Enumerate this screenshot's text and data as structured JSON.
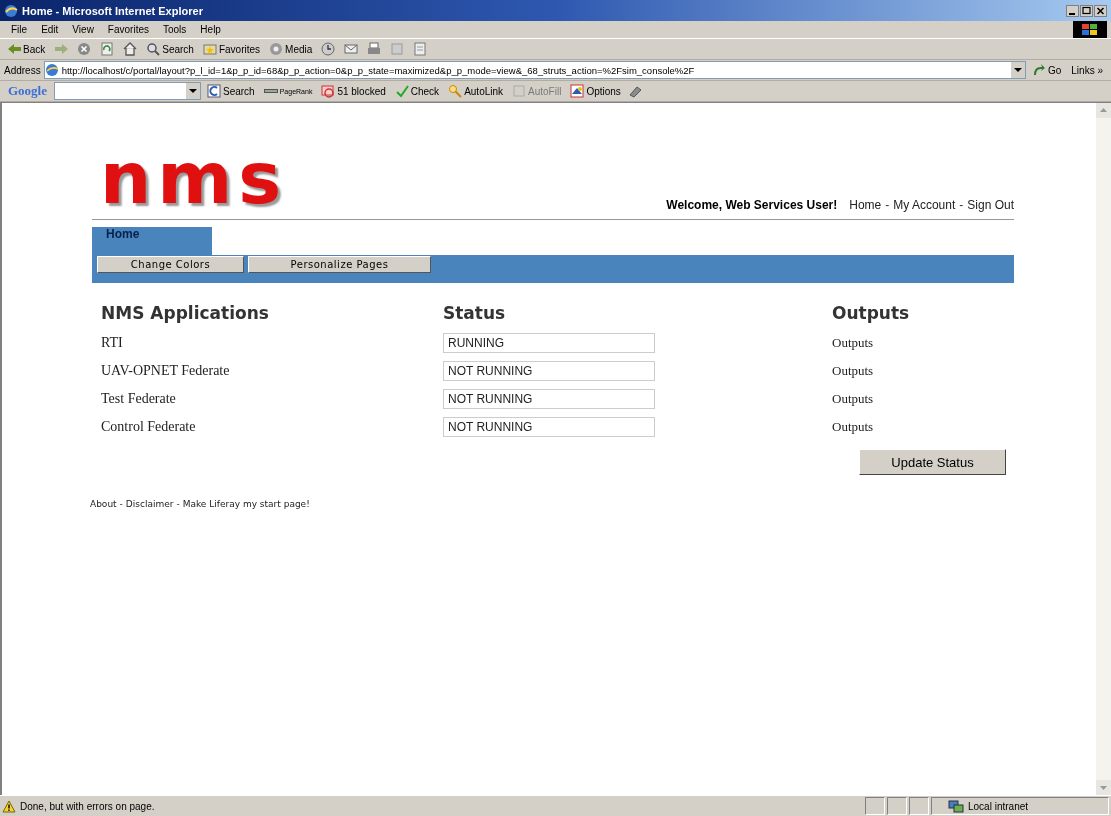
{
  "window": {
    "title": "Home - Microsoft Internet Explorer"
  },
  "menu": [
    "File",
    "Edit",
    "View",
    "Favorites",
    "Tools",
    "Help"
  ],
  "toolbar": [
    {
      "kind": "back",
      "label": "Back"
    },
    {
      "kind": "forward"
    },
    {
      "kind": "stop"
    },
    {
      "kind": "refresh"
    },
    {
      "kind": "home"
    },
    {
      "kind": "search",
      "label": "Search"
    },
    {
      "kind": "favorites",
      "label": "Favorites"
    },
    {
      "kind": "media",
      "label": "Media"
    },
    {
      "kind": "history"
    },
    {
      "kind": "mail"
    },
    {
      "kind": "print"
    },
    {
      "kind": "edit"
    },
    {
      "kind": "discuss"
    }
  ],
  "address": {
    "label": "Address",
    "url": "http://localhost/c/portal/layout?p_l_id=1&p_p_id=68&p_p_action=0&p_p_state=maximized&p_p_mode=view&_68_struts_action=%2Fsim_console%2F",
    "go": "Go",
    "links": "Links »"
  },
  "google_toolbar": {
    "logo": "Google",
    "items": [
      {
        "kind": "search",
        "label": "Search",
        "disabled": false
      },
      {
        "kind": "pagerank",
        "label": "PageRank",
        "disabled": false
      },
      {
        "kind": "blocked",
        "label": "51 blocked",
        "disabled": false
      },
      {
        "kind": "check",
        "label": "Check",
        "disabled": false
      },
      {
        "kind": "autolink",
        "label": "AutoLink",
        "disabled": false
      },
      {
        "kind": "autofill",
        "label": "AutoFill",
        "disabled": true
      },
      {
        "kind": "options",
        "label": "Options",
        "disabled": false
      }
    ]
  },
  "page": {
    "logo": "nms",
    "welcome": "Welcome, Web Services User!",
    "nav_links": [
      "Home",
      "My Account",
      "Sign Out"
    ],
    "separator": "-",
    "tabs": [
      {
        "label": "Home",
        "selected": true
      }
    ],
    "buttons": [
      "Change Colors",
      "Personalize Pages"
    ],
    "table": {
      "columns": [
        "NMS Applications",
        "Status",
        "Outputs"
      ],
      "rows": [
        {
          "name": "RTI",
          "status": "RUNNING",
          "output": "Outputs"
        },
        {
          "name": "UAV-OPNET Federate",
          "status": "NOT RUNNING",
          "output": "Outputs"
        },
        {
          "name": "Test Federate",
          "status": "NOT RUNNING",
          "output": "Outputs"
        },
        {
          "name": "Control Federate",
          "status": "NOT RUNNING",
          "output": "Outputs"
        }
      ]
    },
    "update_button": "Update Status",
    "footer_links": [
      "About",
      "Disclaimer",
      "Make Liferay my start page!"
    ]
  },
  "status_bar": {
    "text": "Done, but with errors on page.",
    "zone": "Local intranet"
  }
}
